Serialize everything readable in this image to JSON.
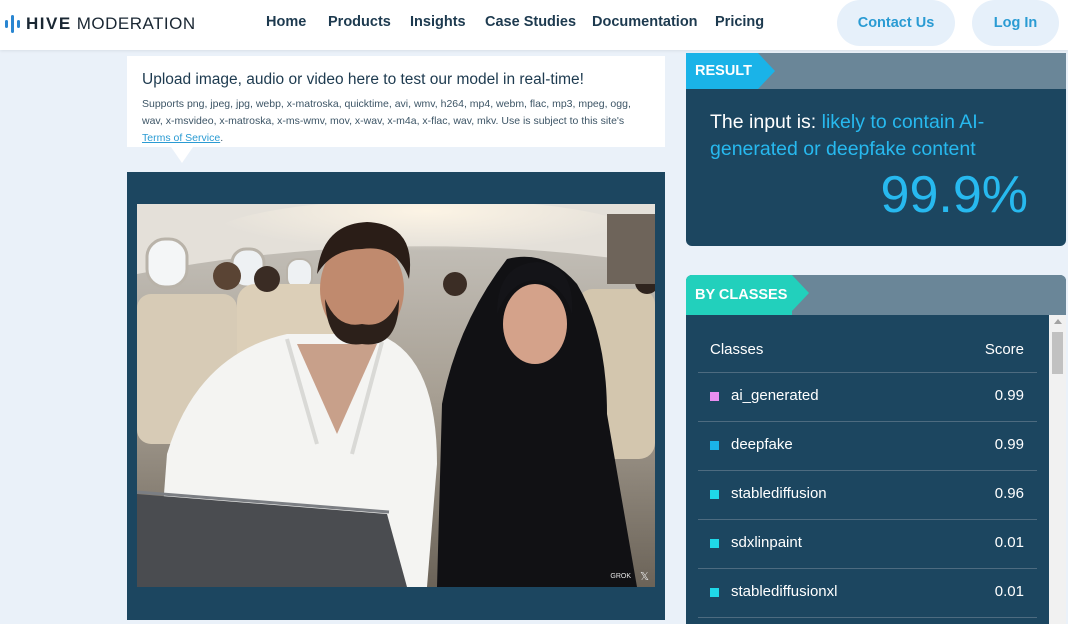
{
  "nav": {
    "logo_primary": "HIVE",
    "logo_secondary": "MODERATION",
    "links": [
      "Home",
      "Products",
      "Insights",
      "Case Studies",
      "Documentation",
      "Pricing"
    ],
    "contact_label": "Contact Us",
    "login_label": "Log In"
  },
  "upload": {
    "title": "Upload image, audio or video here to test our model in real-time!",
    "formats_text": "Supports png, jpeg, jpg, webp, x-matroska, quicktime, avi, wmv, h264, mp4, webm, flac, mp3, mpeg, ogg, wav, x-msvideo, x-matroska, x-ms-wmv, mov, x-wav, x-m4a, x-flac, wav, mkv. Use is subject to this site's ",
    "terms_link": "Terms of Service",
    "terms_suffix": "."
  },
  "image": {
    "watermark": "GROK"
  },
  "result": {
    "tag": "RESULT",
    "prefix": "The input is: ",
    "verdict": "likely to contain AI-generated or deepfake content",
    "score": "99.9%"
  },
  "classes": {
    "tag": "BY CLASSES",
    "header_class": "Classes",
    "header_score": "Score",
    "rows": [
      {
        "name": "ai_generated",
        "score": "0.99",
        "color": "#e88ef0"
      },
      {
        "name": "deepfake",
        "score": "0.99",
        "color": "#1ab3e8"
      },
      {
        "name": "stablediffusion",
        "score": "0.96",
        "color": "#1fd8e8"
      },
      {
        "name": "sdxlinpaint",
        "score": "0.01",
        "color": "#1fd8e8"
      },
      {
        "name": "stablediffusionxl",
        "score": "0.01",
        "color": "#1fd8e8"
      }
    ]
  },
  "colors": {
    "accent": "#1ab3e8",
    "panel": "#1c4660",
    "tag_green": "#22d0bc"
  }
}
